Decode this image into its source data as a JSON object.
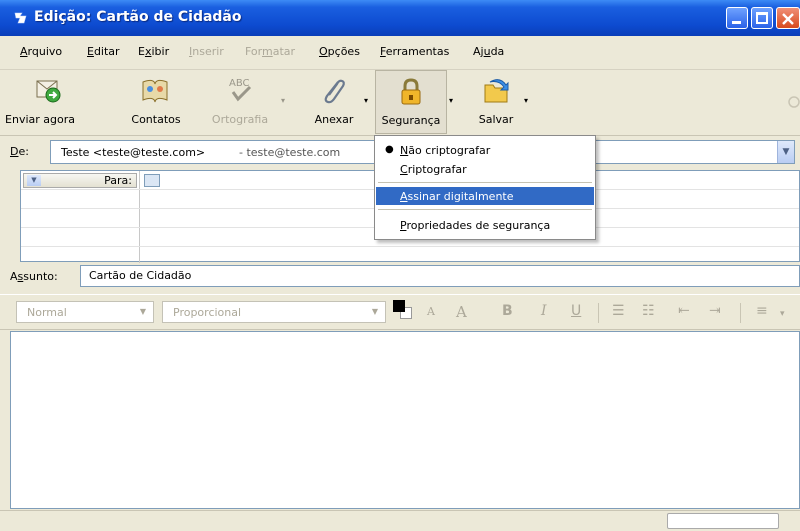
{
  "window": {
    "title": "Edição: Cartão de Cidadão"
  },
  "menubar": {
    "items": [
      {
        "prefix": "",
        "key": "A",
        "rest": "rquivo",
        "disabled": false
      },
      {
        "prefix": "",
        "key": "E",
        "rest": "ditar",
        "disabled": false
      },
      {
        "prefix": "E",
        "key": "x",
        "rest": "ibir",
        "disabled": false
      },
      {
        "prefix": "",
        "key": "I",
        "rest": "nserir",
        "disabled": true
      },
      {
        "prefix": "For",
        "key": "m",
        "rest": "atar",
        "disabled": true
      },
      {
        "prefix": "",
        "key": "O",
        "rest": "pções",
        "disabled": false
      },
      {
        "prefix": "",
        "key": "F",
        "rest": "erramentas",
        "disabled": false
      },
      {
        "prefix": "Aj",
        "key": "u",
        "rest": "da",
        "disabled": false
      }
    ]
  },
  "toolbar": {
    "send": "Enviar agora",
    "contacts": "Contatos",
    "spelling": "Ortografia",
    "spelling_badge": "ABC",
    "attach": "Anexar",
    "security": "Segurança",
    "save": "Salvar"
  },
  "header": {
    "from_label_key": "D",
    "from_label_rest": "e:",
    "from_value": "Teste <teste@teste.com>",
    "from_email": "- teste@teste.com",
    "to_label": "Para:",
    "subject_label_pre": "A",
    "subject_label_key": "s",
    "subject_label_rest": "sunto:",
    "subject_value": "Cartão de Cidadão"
  },
  "format": {
    "paragraph": "Normal",
    "font": "Proporcional",
    "smaller": "A",
    "larger": "A",
    "bold": "B",
    "italic": "I",
    "underline": "U"
  },
  "security_menu": {
    "items": [
      {
        "key": "N",
        "rest": "ão criptografar",
        "checked": true,
        "selected": false
      },
      {
        "key": "C",
        "rest": "riptografar",
        "checked": false,
        "selected": false
      },
      {
        "key": "A",
        "rest": "ssinar digitalmente",
        "checked": false,
        "selected": true
      },
      {
        "key": "P",
        "rest": "ropriedades de segurança",
        "checked": false,
        "selected": false
      }
    ]
  },
  "colors": {
    "titlebar": "#0d4bd0",
    "menu_highlight": "#316ac5",
    "chrome": "#ece9d8"
  }
}
